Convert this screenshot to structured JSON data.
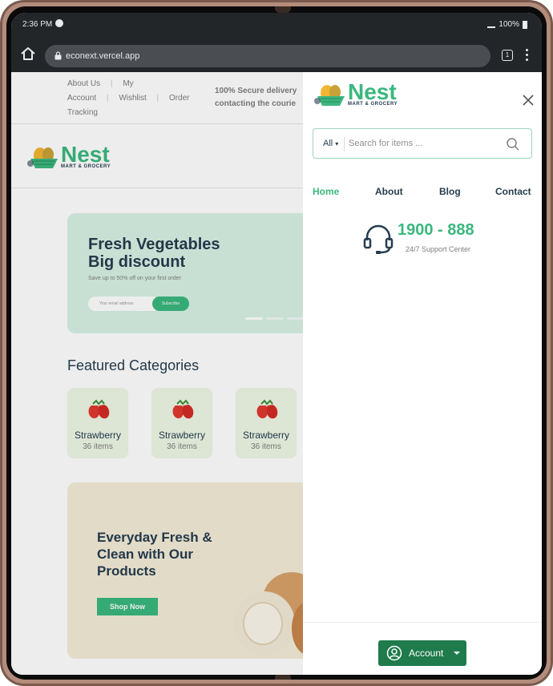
{
  "status_bar": {
    "time": "2:36 PM",
    "battery": "100%"
  },
  "browser": {
    "url": "econext.vercel.app",
    "tab_count": "1"
  },
  "page": {
    "top_links": [
      "About Us",
      "My",
      "Account",
      "Wishlist",
      "Order",
      "Tracking"
    ],
    "notice_line1": "100% Secure delivery",
    "notice_line2": "contacting the courie",
    "logo": {
      "title": "Nest",
      "subtitle": "MART & GROCERY"
    },
    "hero": {
      "title": "Fresh Vegetables Big discount",
      "subtitle": "Save up to 50% off on your first order",
      "input_placeholder": "Your email address",
      "button": "Subscribe"
    },
    "featured_title": "Featured Categories",
    "categories": [
      {
        "name": "Strawberry",
        "count": "36 items"
      },
      {
        "name": "Strawberry",
        "count": "36 items"
      },
      {
        "name": "Strawberry",
        "count": "36 items"
      }
    ],
    "promo": {
      "title": "Everyday Fresh & Clean with Our Products",
      "button": "Shop Now"
    }
  },
  "drawer": {
    "logo": {
      "title": "Nest",
      "subtitle": "MART & GROCERY"
    },
    "search": {
      "category": "All",
      "placeholder": "Search for items ..."
    },
    "nav": [
      "Home",
      "About",
      "Blog",
      "Contact"
    ],
    "active_nav": "Home",
    "support": {
      "phone": "1900 - 888",
      "label": "24/7 Support Center"
    },
    "account_label": "Account"
  },
  "colors": {
    "brand_green": "#3bb77e",
    "dark_green_button": "#1f7a4c",
    "heading": "#253d4e"
  }
}
